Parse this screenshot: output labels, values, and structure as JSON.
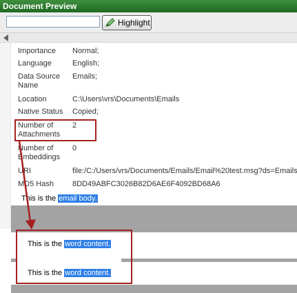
{
  "window": {
    "title": "Document Preview"
  },
  "toolbar": {
    "search": {
      "value": "",
      "placeholder": ""
    },
    "highlight_label": "Highlight"
  },
  "properties": [
    {
      "label": "Importance",
      "value": "Normal;"
    },
    {
      "label": "Language",
      "value": "English;"
    },
    {
      "label": "Data Source Name",
      "value": "Emails;"
    },
    {
      "label": "Location",
      "value": "C:\\Users\\vrs\\Documents\\Emails"
    },
    {
      "label": "Native Status",
      "value": "Copied;"
    },
    {
      "label": "Number of Attachments",
      "value": "2"
    },
    {
      "label": "Number of Embeddings",
      "value": "0"
    },
    {
      "label": "URI",
      "value": "file:/C:/Users/vrs/Documents/Emails/Email%20test.msg?ds=Emails"
    },
    {
      "label": "MD5 Hash",
      "value": "8DD49ABFC3026B82D6AE6F4092BD68A6"
    }
  ],
  "email_body": {
    "prefix": "This is the ",
    "highlighted": "email body."
  },
  "attachments": [
    {
      "prefix": "This is the ",
      "highlighted": "word content."
    },
    {
      "prefix": "This is the ",
      "highlighted": "word content."
    }
  ],
  "colors": {
    "title_bar": "#2a7a2d",
    "highlight": "#2f7fe6",
    "annotation": "#a52020"
  }
}
